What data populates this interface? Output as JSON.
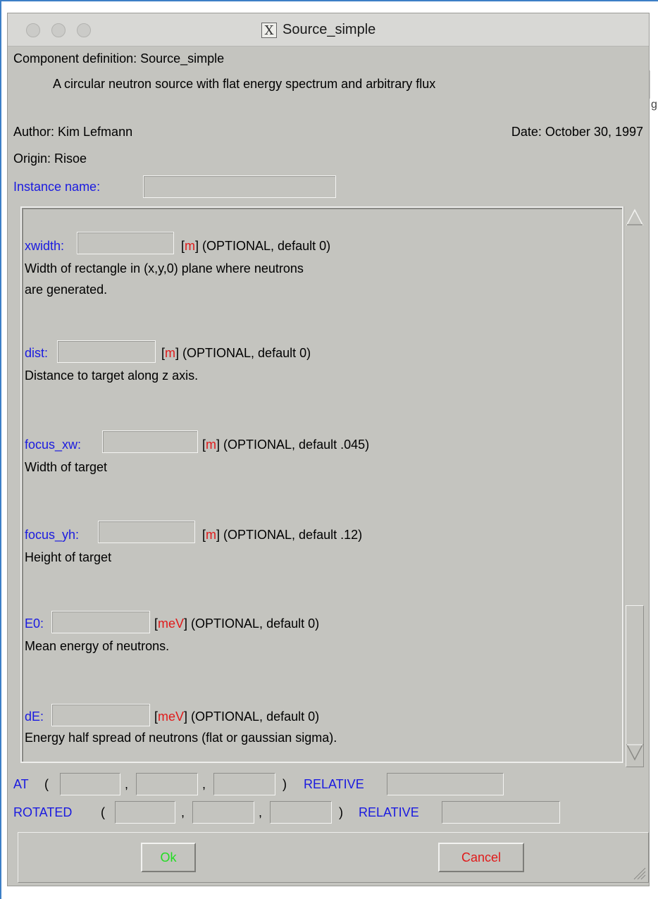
{
  "window": {
    "title": "Source_simple"
  },
  "header": {
    "component_definition": "Component definition: Source_simple",
    "description": "A circular neutron source with flat energy spectrum and arbitrary flux",
    "author": "Author:  Kim Lefmann",
    "date": "Date:  October 30, 1997",
    "origin": "Origin:  Risoe",
    "instance_label": "Instance name:",
    "instance_value": ""
  },
  "params": [
    {
      "name": "xwidth:",
      "value": "",
      "unit": "m",
      "info": "(OPTIONAL, default 0)",
      "desc1": "Width of rectangle in (x,y,0) plane where neutrons",
      "desc2": "are generated."
    },
    {
      "name": "dist:",
      "value": "",
      "unit": "m",
      "info": "(OPTIONAL, default 0)",
      "desc1": "Distance to target along z axis.",
      "desc2": ""
    },
    {
      "name": "focus_xw:",
      "value": "",
      "unit": "m",
      "info": "(OPTIONAL, default .045)",
      "desc1": "Width of target",
      "desc2": ""
    },
    {
      "name": "focus_yh:",
      "value": "",
      "unit": "m",
      "info": "(OPTIONAL, default .12)",
      "desc1": "Height of target",
      "desc2": ""
    },
    {
      "name": "E0:",
      "value": "",
      "unit": "meV",
      "info": "(OPTIONAL, default 0)",
      "desc1": "Mean energy of neutrons.",
      "desc2": ""
    },
    {
      "name": "dE:",
      "value": "",
      "unit": "meV",
      "info": "(OPTIONAL, default 0)",
      "desc1": "Energy half spread of neutrons (flat or gaussian sigma).",
      "desc2": ""
    }
  ],
  "placement": {
    "at_label": "AT",
    "rotated_label": "ROTATED",
    "open_paren": "(",
    "close_paren": ")",
    "comma": ",",
    "relative_label": "RELATIVE",
    "at_x": "",
    "at_y": "",
    "at_z": "",
    "at_relative": "",
    "rot_x": "",
    "rot_y": "",
    "rot_z": "",
    "rot_relative": ""
  },
  "buttons": {
    "ok": "Ok",
    "cancel": "Cancel"
  },
  "edge_fragment": "g",
  "colors": {
    "label_blue": "#1a1ae0",
    "unit_red": "#e01a1a",
    "ok_green": "#22dd22",
    "background": "#c4c4bf"
  }
}
